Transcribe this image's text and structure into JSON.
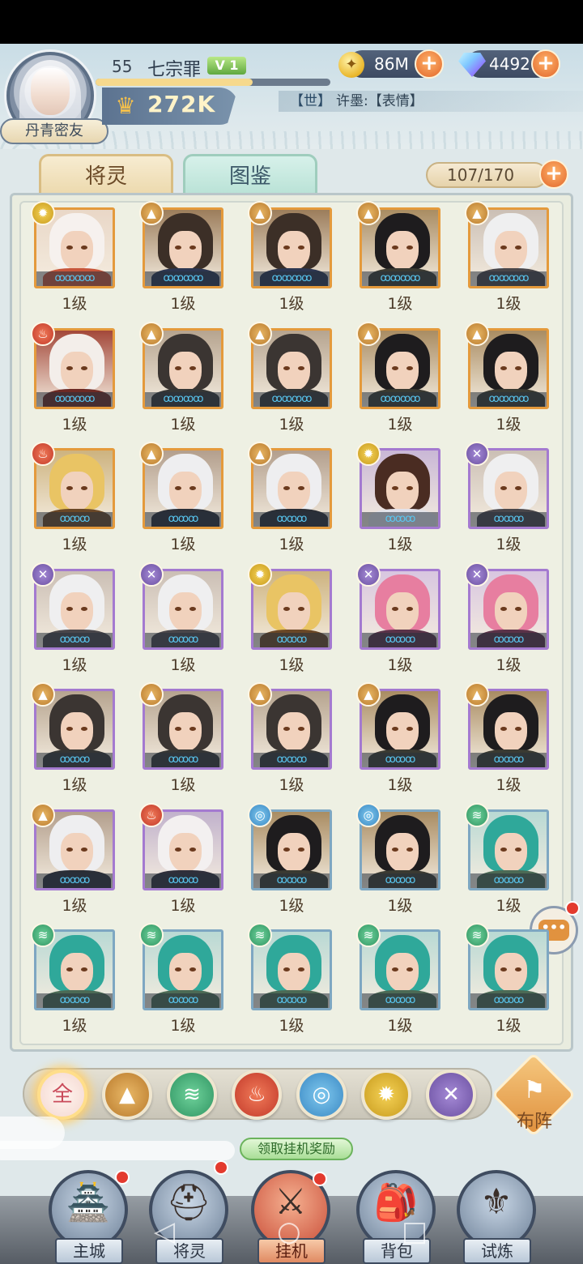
{
  "player": {
    "level": "55",
    "name": "七宗罪",
    "vip": "V 1",
    "exp_progress": 0.67,
    "power": "272K",
    "avatar_tag": "丹青密友"
  },
  "resources": {
    "gold": "86M",
    "gems": "4492"
  },
  "world_chat": {
    "channel": "【世】",
    "message": "许墨:【表情】"
  },
  "tabs": {
    "spirits": "将灵",
    "collection": "图鉴"
  },
  "capacity": "107/170",
  "cards": [
    {
      "element": "sun",
      "level": "1级",
      "frame": "gold",
      "palette": "whitehair",
      "stars": "ꝏꝏꝏꝏ"
    },
    {
      "element": "earth",
      "level": "1级",
      "frame": "gold",
      "palette": "darkbrown",
      "stars": "ꝏꝏꝏꝏ"
    },
    {
      "element": "earth",
      "level": "1级",
      "frame": "gold",
      "palette": "darkbrown",
      "stars": "ꝏꝏꝏꝏ"
    },
    {
      "element": "earth",
      "level": "1级",
      "frame": "gold",
      "palette": "black",
      "stars": "ꝏꝏꝏꝏ"
    },
    {
      "element": "earth",
      "level": "1级",
      "frame": "gold",
      "palette": "silver",
      "stars": "ꝏꝏꝏꝏ"
    },
    {
      "element": "fire",
      "level": "1级",
      "frame": "gold",
      "palette": "redwhite",
      "stars": "ꝏꝏꝏꝏ"
    },
    {
      "element": "earth",
      "level": "1级",
      "frame": "gold",
      "palette": "darkgray",
      "stars": "ꝏꝏꝏꝏ"
    },
    {
      "element": "earth",
      "level": "1级",
      "frame": "gold",
      "palette": "darkgray",
      "stars": "ꝏꝏꝏꝏ"
    },
    {
      "element": "earth",
      "level": "1级",
      "frame": "gold",
      "palette": "black",
      "stars": "ꝏꝏꝏꝏ"
    },
    {
      "element": "earth",
      "level": "1级",
      "frame": "gold",
      "palette": "black",
      "stars": "ꝏꝏꝏꝏ"
    },
    {
      "element": "fire",
      "level": "1级",
      "frame": "gold",
      "palette": "blonde",
      "stars": "ꝏꝏꝏ"
    },
    {
      "element": "earth",
      "level": "1级",
      "frame": "gold",
      "palette": "whitetan",
      "stars": "ꝏꝏꝏ"
    },
    {
      "element": "earth",
      "level": "1级",
      "frame": "gold",
      "palette": "whitetan",
      "stars": "ꝏꝏꝏ"
    },
    {
      "element": "sun",
      "level": "1级",
      "frame": "purple",
      "palette": "brown",
      "stars": "ꝏꝏꝏ"
    },
    {
      "element": "dark",
      "level": "1级",
      "frame": "purple",
      "palette": "silver",
      "stars": "ꝏꝏꝏ"
    },
    {
      "element": "dark",
      "level": "1级",
      "frame": "purple",
      "palette": "silver",
      "stars": "ꝏꝏꝏ"
    },
    {
      "element": "dark",
      "level": "1级",
      "frame": "purple",
      "palette": "silver",
      "stars": "ꝏꝏꝏ"
    },
    {
      "element": "sun",
      "level": "1级",
      "frame": "purple",
      "palette": "blonde",
      "stars": "ꝏꝏꝏ"
    },
    {
      "element": "dark",
      "level": "1级",
      "frame": "purple",
      "palette": "pink",
      "stars": "ꝏꝏꝏ"
    },
    {
      "element": "dark",
      "level": "1级",
      "frame": "purple",
      "palette": "pink",
      "stars": "ꝏꝏꝏ"
    },
    {
      "element": "earth",
      "level": "1级",
      "frame": "purple",
      "palette": "darkgray",
      "stars": "ꝏꝏꝏ"
    },
    {
      "element": "earth",
      "level": "1级",
      "frame": "purple",
      "palette": "darkgray",
      "stars": "ꝏꝏꝏ"
    },
    {
      "element": "earth",
      "level": "1级",
      "frame": "purple",
      "palette": "darkgray",
      "stars": "ꝏꝏꝏ"
    },
    {
      "element": "earth",
      "level": "1级",
      "frame": "purple",
      "palette": "black",
      "stars": "ꝏꝏꝏ"
    },
    {
      "element": "earth",
      "level": "1级",
      "frame": "purple",
      "palette": "black",
      "stars": "ꝏꝏꝏ"
    },
    {
      "element": "earth",
      "level": "1级",
      "frame": "purple",
      "palette": "whitetan",
      "stars": "ꝏꝏꝏ"
    },
    {
      "element": "fire",
      "level": "1级",
      "frame": "purple",
      "palette": "whitered",
      "stars": "ꝏꝏꝏ"
    },
    {
      "element": "water",
      "level": "1级",
      "frame": "blue",
      "palette": "black",
      "stars": "ꝏꝏꝏ"
    },
    {
      "element": "water",
      "level": "1级",
      "frame": "blue",
      "palette": "black",
      "stars": "ꝏꝏꝏ"
    },
    {
      "element": "wind",
      "level": "1级",
      "frame": "blue",
      "palette": "teal",
      "stars": "ꝏꝏꝏ"
    },
    {
      "element": "wind",
      "level": "1级",
      "frame": "blue",
      "palette": "teal",
      "stars": "ꝏꝏꝏ"
    },
    {
      "element": "wind",
      "level": "1级",
      "frame": "blue",
      "palette": "teal",
      "stars": "ꝏꝏꝏ"
    },
    {
      "element": "wind",
      "level": "1级",
      "frame": "blue",
      "palette": "teal",
      "stars": "ꝏꝏꝏ"
    },
    {
      "element": "wind",
      "level": "1级",
      "frame": "blue",
      "palette": "teal",
      "stars": "ꝏꝏꝏ"
    },
    {
      "element": "wind",
      "level": "1级",
      "frame": "blue",
      "palette": "teal",
      "stars": "ꝏꝏꝏ"
    }
  ],
  "filters": {
    "all": "全",
    "items": [
      "earth",
      "wind",
      "fire",
      "water",
      "sun",
      "dark"
    ]
  },
  "formation_label": "布阵",
  "idle_reward": "领取挂机奖励",
  "nav": {
    "main_city": "主城",
    "spirits": "将灵",
    "idle": "挂机",
    "backpack": "背包",
    "trial": "试炼"
  }
}
